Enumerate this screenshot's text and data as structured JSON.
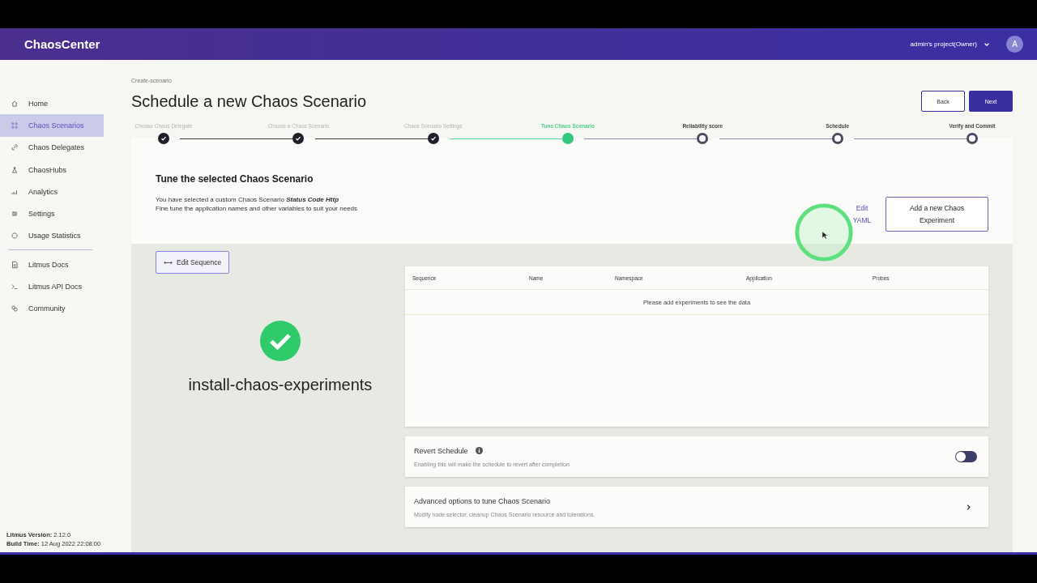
{
  "header": {
    "logo": "ChaosCenter",
    "project": "admin's project(Owner)",
    "avatar": "A"
  },
  "sidebar": {
    "items": [
      {
        "label": "Home",
        "selected": false
      },
      {
        "label": "Chaos Scenarios",
        "selected": true
      },
      {
        "label": "Chaos Delegates",
        "selected": false
      },
      {
        "label": "ChaosHubs",
        "selected": false
      },
      {
        "label": "Analytics",
        "selected": false
      },
      {
        "label": "Settings",
        "selected": false
      },
      {
        "label": "Usage Statistics",
        "selected": false
      }
    ],
    "links": [
      {
        "label": "Litmus Docs"
      },
      {
        "label": "Litmus API Docs"
      },
      {
        "label": "Community"
      }
    ],
    "version": "**Litmus Version:** 2.12.0",
    "build": "**Build Time:** 12 Aug 2022 22:08:00"
  },
  "breadcrumb": "Create-scenario",
  "title": "Schedule a new Chaos Scenario",
  "buttons": {
    "back": "Back",
    "next": "Next"
  },
  "steps": [
    {
      "label": "Choose Chaos Delegate",
      "kind": "done"
    },
    {
      "label": "Choose a Chaos Scenario",
      "kind": "done"
    },
    {
      "label": "Chaos Scenario Settings",
      "kind": "done"
    },
    {
      "label": "Tune Chaos Scenario",
      "kind": "current"
    },
    {
      "label": "Reliability score",
      "kind": "pending"
    },
    {
      "label": "Schedule",
      "kind": "pending"
    },
    {
      "label": "Verify and Commit",
      "kind": "pending"
    }
  ],
  "tune": {
    "heading": "Tune the selected Chaos Scenario",
    "line1": "You have selected a custom Chaos Scenario **Status Code Http**",
    "line2": "Fine tune the application names and other variables to suit your needs",
    "edit_yaml": "Edit YAML",
    "add_experiment": "Add a new Chaos Experiment"
  },
  "edit_sequence": "Edit Sequence",
  "experiment_name": "install-chaos-experiments",
  "table": {
    "columns": [
      "Sequence",
      "Name",
      "Namespace",
      "Application",
      "Probes"
    ],
    "empty": "Please add experiments to see the data"
  },
  "revert": {
    "title": "Revert Schedule",
    "description": "Enabling this will make the schedule to revert after completion",
    "on": false
  },
  "advanced": {
    "title": "Advanced options to tune Chaos Scenario",
    "description": "Modify node selector, cleanup Chaos Scenario resource and tolerations."
  }
}
